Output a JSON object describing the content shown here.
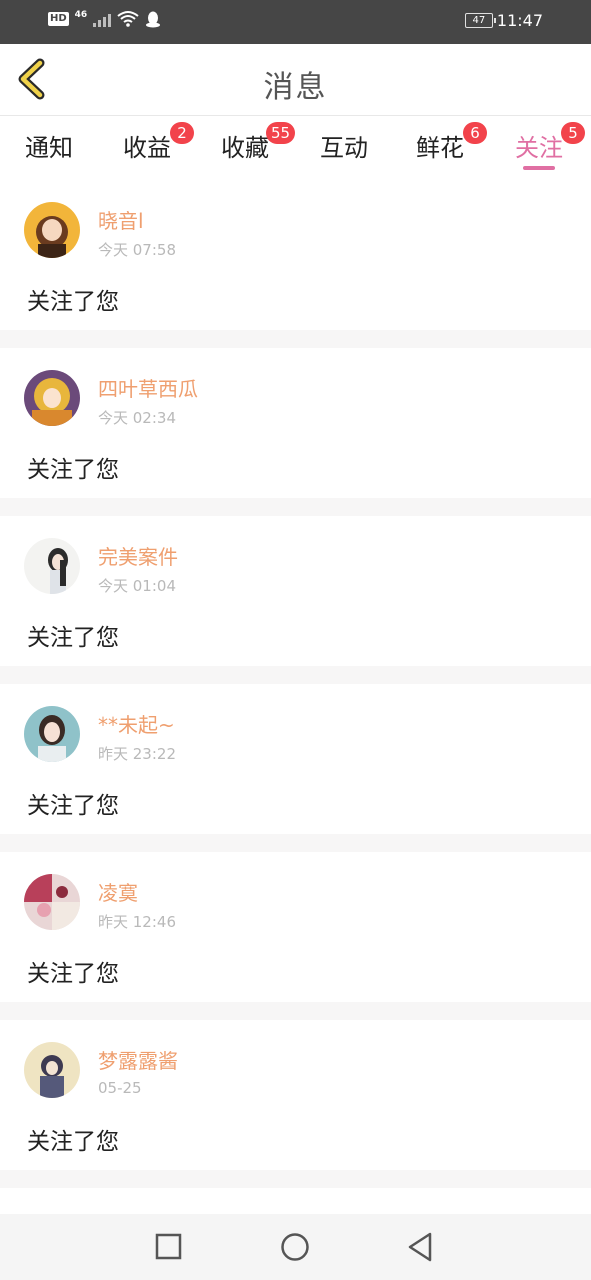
{
  "status_bar": {
    "hd": "HD",
    "network": "46",
    "battery": "47",
    "time": "11:47"
  },
  "header": {
    "title": "消息",
    "back_icon": "chevron-left-icon"
  },
  "tabs": [
    {
      "label": "通知",
      "badge": ""
    },
    {
      "label": "收益",
      "badge": "2"
    },
    {
      "label": "收藏",
      "badge": "55"
    },
    {
      "label": "互动",
      "badge": ""
    },
    {
      "label": "鲜花",
      "badge": "6"
    },
    {
      "label": "关注",
      "badge": "5"
    }
  ],
  "active_tab": "关注",
  "messages": [
    {
      "name": "晓音l",
      "time": "今天 07:58",
      "text": "关注了您"
    },
    {
      "name": "四叶草西瓜",
      "time": "今天 02:34",
      "text": "关注了您"
    },
    {
      "name": "完美案件",
      "time": "今天 01:04",
      "text": "关注了您"
    },
    {
      "name": "**未起~",
      "time": "昨天 23:22",
      "text": "关注了您"
    },
    {
      "name": "凌寞",
      "time": "昨天 12:46",
      "text": "关注了您"
    },
    {
      "name": "梦露露酱",
      "time": "05-25",
      "text": "关注了您"
    }
  ],
  "colors": {
    "accent": "#e06fa3",
    "name": "#ef9f6f",
    "badge": "#f2434b",
    "back_icon": "#f0d24a"
  },
  "nav": [
    "square-icon",
    "circle-icon",
    "triangle-back-icon"
  ]
}
